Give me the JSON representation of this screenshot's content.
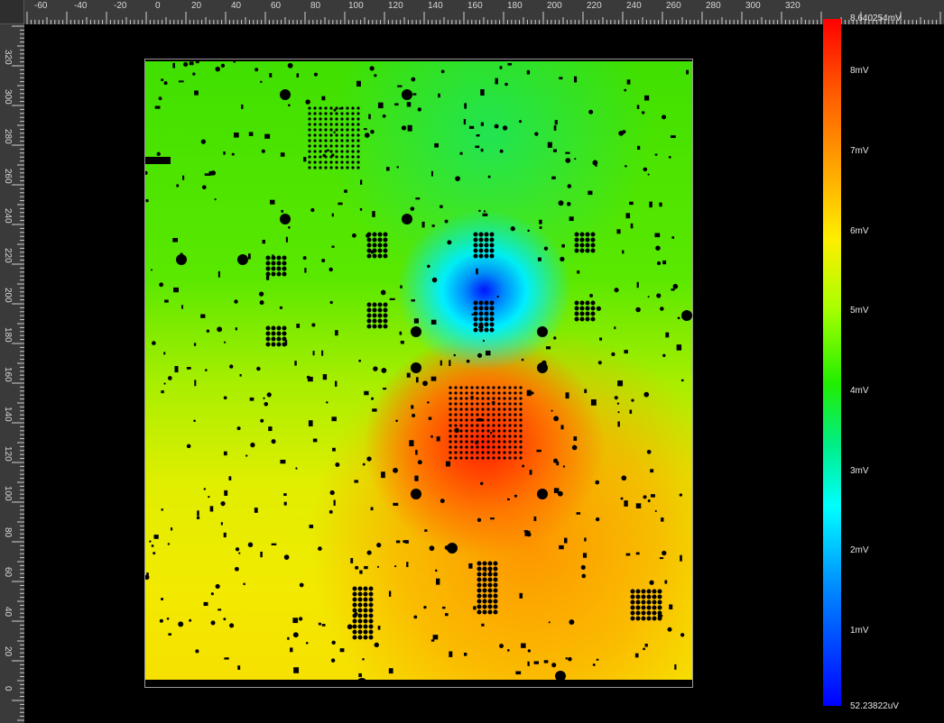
{
  "ruler_top": {
    "ticks": [
      "-60",
      "-40",
      "-20",
      "0",
      "20",
      "40",
      "60",
      "80",
      "100",
      "120",
      "140",
      "160",
      "180",
      "200",
      "220",
      "240",
      "260",
      "280",
      "300",
      "320"
    ]
  },
  "ruler_left": {
    "ticks": [
      "320",
      "300",
      "280",
      "260",
      "240",
      "220",
      "200",
      "180",
      "160",
      "140",
      "120",
      "100",
      "80",
      "60",
      "40",
      "20",
      "0"
    ]
  },
  "colorbar": {
    "max_label": "8.640254mV",
    "min_label": "52.23822uV",
    "ticks": [
      "8mV",
      "7mV",
      "6mV",
      "5mV",
      "4mV",
      "3mV",
      "2mV",
      "1mV"
    ],
    "colors": [
      "#ff0000",
      "#ff9900",
      "#ffee00",
      "#22ee00",
      "#00ffff",
      "#0000ff"
    ]
  }
}
